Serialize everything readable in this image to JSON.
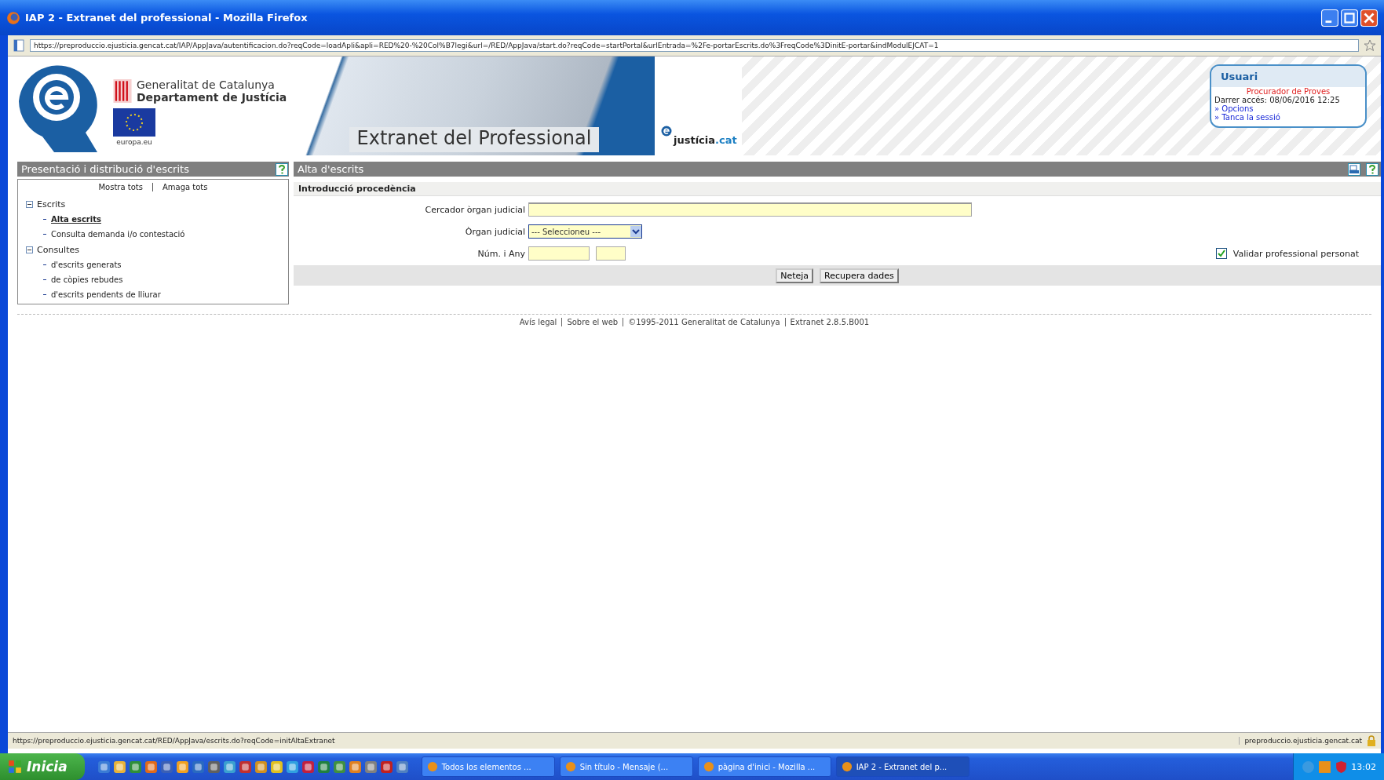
{
  "window": {
    "title": "IAP 2 - Extranet del professional - Mozilla Firefox"
  },
  "address_bar": {
    "url": "https://preproduccio.ejusticia.gencat.cat/IAP/AppJava/autentificacion.do?reqCode=loadApli&apli=RED%20-%20Col%B7legi&url=/RED/AppJava/start.do?reqCode=startPortal&urlEntrada=%2Fe-portarEscrits.do%3FreqCode%3DinitE-portar&indModulEJCAT=1"
  },
  "banner": {
    "org_line_1": "Generalitat de Catalunya",
    "org_line_2": "Departament de Justícia",
    "eu_caption": "europa.eu",
    "title": "Extranet del Professional",
    "brand_prefix": "justícia",
    "brand_suffix": ".cat"
  },
  "user_box": {
    "title": "Usuari",
    "name": "Procurador de Proves",
    "last_access": "Darrer accés: 08/06/2016 12:25",
    "links": [
      "» Opcions",
      "» Tanca la sessió"
    ]
  },
  "sidebar": {
    "title": "Presentació i distribució d'escrits",
    "show_all": "Mostra tots",
    "hide_all": "Amaga tots",
    "tree": [
      {
        "label": "Escrits",
        "expanded": true,
        "children": [
          {
            "label": "Alta escrits",
            "selected": true
          },
          {
            "label": "Consulta demanda i/o contestació",
            "selected": false
          }
        ]
      },
      {
        "label": "Consultes",
        "expanded": true,
        "children": [
          {
            "label": "d'escrits generats",
            "selected": false
          },
          {
            "label": "de còpies rebudes",
            "selected": false
          },
          {
            "label": "d'escrits pendents de lliurar",
            "selected": false
          }
        ]
      }
    ]
  },
  "main": {
    "title": "Alta d'escrits",
    "section": "Introducció procedència",
    "fields": [
      {
        "label": "Cercador òrgan judicial",
        "kind": "text"
      },
      {
        "label": "Òrgan judicial",
        "kind": "select",
        "value": "--- Seleccioneu ---"
      },
      {
        "label": "Núm. i Any",
        "kind": "pair"
      }
    ],
    "checkbox": {
      "label": "Validar professional personat",
      "checked": true
    },
    "buttons": [
      "Neteja",
      "Recupera dades"
    ]
  },
  "footer": [
    "Avís legal",
    "Sobre el web",
    "©1995-2011 Generalitat de Catalunya",
    "Extranet 2.8.5.B001"
  ],
  "status_bar": {
    "url": "https://preproduccio.ejusticia.gencat.cat/RED/AppJava/escrits.do?reqCode=initAltaExtranet",
    "host": "preproduccio.ejusticia.gencat.cat"
  },
  "taskbar": {
    "start": "Inicia",
    "tasks": [
      {
        "label": "Todos los elementos ...",
        "selected": false
      },
      {
        "label": "Sin título - Mensaje (...",
        "selected": false
      },
      {
        "label": "pàgina d'inici - Mozilla ...",
        "selected": false
      },
      {
        "label": "IAP 2 - Extranet del p...",
        "selected": true
      }
    ],
    "clock": "13:02"
  }
}
